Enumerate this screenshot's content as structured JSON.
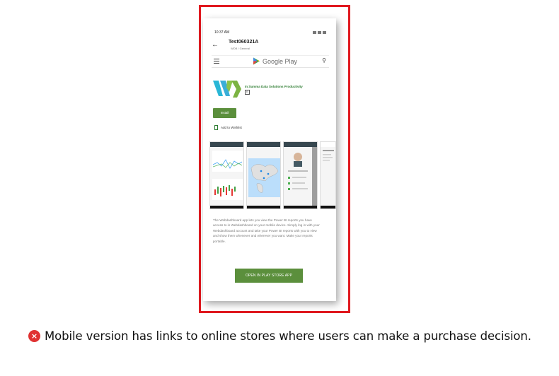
{
  "phone": {
    "status_time": "10:37 AM",
    "title": "Test060321A",
    "subtitle": "WDB / General",
    "store_name": "Google Play",
    "developer_line": "In:Summa Data Solutions  Productivity",
    "install_label": "Install",
    "wishlist_label": "Add to Wishlist",
    "description": "The Webdashboard app lets you view the Power BI reports you have access to in Webdashboard on your mobile device. Simply log in with your Webdashboard account and take your Power BI reports with you to view and show them whenever and wherever you want. Make your reports portable.",
    "open_store_label": "OPEN IN PLAY STORE APP"
  },
  "caption": {
    "icon": "error-x-icon",
    "text": "Mobile version has links to online stores where users can make a purchase decision."
  },
  "colors": {
    "frame": "#e0191f",
    "accent_green": "#5b8f3c",
    "error_red": "#e03232"
  }
}
